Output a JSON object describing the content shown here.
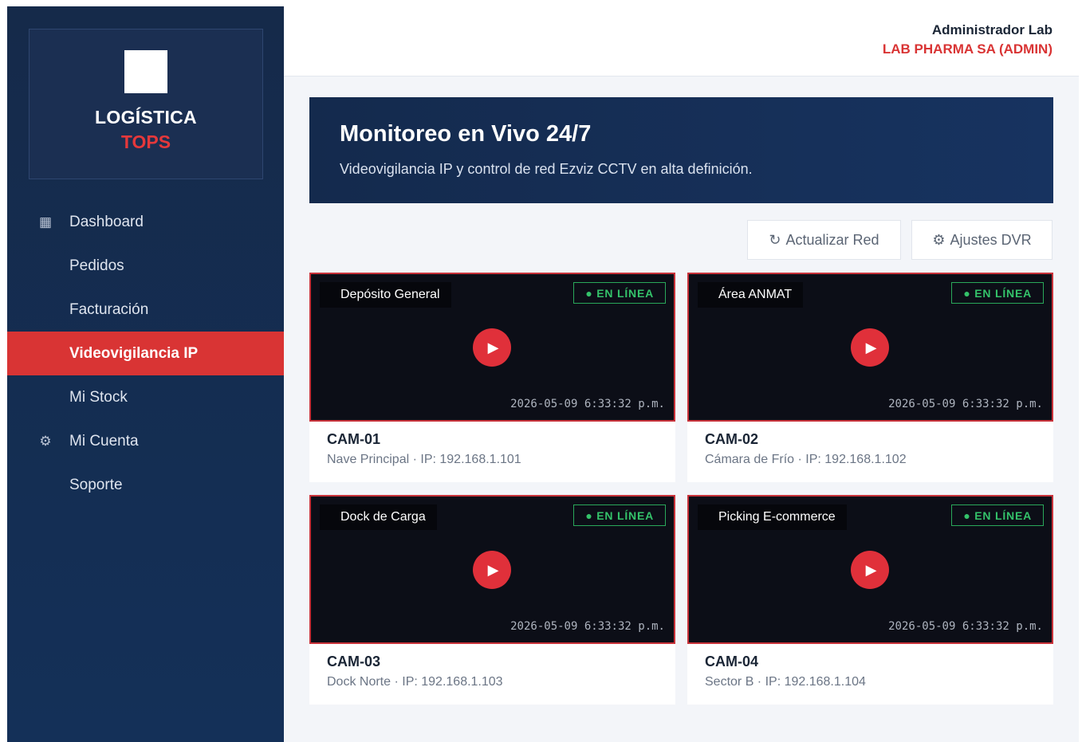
{
  "sidebar": {
    "brand": {
      "title": "LOGÍSTICA",
      "subtitle": "TOPS"
    },
    "items": [
      {
        "label": "Dashboard",
        "icon": "grid-icon",
        "glyph": "▦",
        "active": false
      },
      {
        "label": "Pedidos",
        "active": false
      },
      {
        "label": "Facturación",
        "active": false
      },
      {
        "label": "Videovigilancia IP",
        "active": true
      },
      {
        "label": "Mi Stock",
        "active": false
      },
      {
        "label": "Mi Cuenta",
        "icon": "gear-icon",
        "glyph": "⚙",
        "active": false
      },
      {
        "label": "Soporte",
        "active": false
      }
    ]
  },
  "header": {
    "user_name": "Administrador Lab",
    "company": "LAB PHARMA SA (ADMIN)"
  },
  "hero": {
    "title": "Monitoreo en Vivo 24/7",
    "subtitle": "Videovigilancia IP y control de red Ezviz CCTV en alta definición."
  },
  "actions": {
    "refresh_icon": "↻",
    "refresh_label": "Actualizar Red",
    "dvr_icon": "⚙",
    "dvr_label": "Ajustes DVR"
  },
  "cameras": [
    {
      "location": "Depósito General",
      "status": "● EN LÍNEA",
      "timestamp": "2026-05-09 6:33:32 p.m.",
      "id": "CAM-01",
      "description": "Nave Principal · IP: 192.168.1.101"
    },
    {
      "location": "Área ANMAT",
      "status": "● EN LÍNEA",
      "timestamp": "2026-05-09 6:33:32 p.m.",
      "id": "CAM-02",
      "description": "Cámara de Frío · IP: 192.168.1.102"
    },
    {
      "location": "Dock de Carga",
      "status": "● EN LÍNEA",
      "timestamp": "2026-05-09 6:33:32 p.m.",
      "id": "CAM-03",
      "description": "Dock Norte · IP: 192.168.1.103"
    },
    {
      "location": "Picking E-commerce",
      "status": "● EN LÍNEA",
      "timestamp": "2026-05-09 6:33:32 p.m.",
      "id": "CAM-04",
      "description": "Sector B · IP: 192.168.1.104"
    }
  ],
  "play_glyph": "▶",
  "colors": {
    "accent": "#d93434",
    "sidebar": "#152a4a",
    "online": "#34c26a"
  }
}
